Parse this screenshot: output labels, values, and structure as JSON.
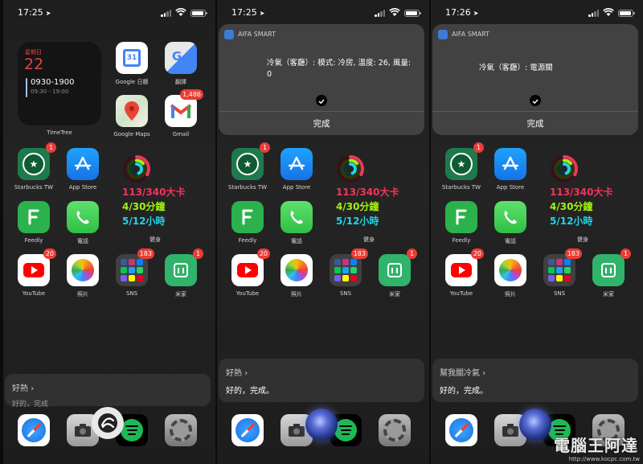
{
  "status": {
    "panel0_time": "17:25",
    "panel1_time": "17:25",
    "panel2_time": "17:26"
  },
  "calendar_widget": {
    "weekday": "星期日",
    "day": "22",
    "event_title": "0930-1900",
    "event_time": "09:30 - 19:00",
    "label": "TimeTree"
  },
  "apps": {
    "google_calendar": "Google 日曆",
    "translate": "翻譯",
    "google_maps": "Google Maps",
    "gmail": "Gmail",
    "gmail_badge": "1,486",
    "starbucks": "Starbucks TW",
    "starbucks_badge": "1",
    "app_store": "App Store",
    "feedly": "Feedly",
    "phone": "電話",
    "youtube": "YouTube",
    "youtube_badge": "20",
    "photos": "照片",
    "sns": "SNS",
    "sns_badge": "183",
    "mijia": "米家",
    "mijia_badge": "1",
    "gcal_day": "31"
  },
  "fitness": {
    "calories": "113/340大卡",
    "minutes": "4/30分鐘",
    "hours": "5/12小時",
    "label": "健身"
  },
  "notifications": {
    "app_name": "AIFA SMART",
    "panel1_message": "冷氣（客廳）: 模式: 冷房, 溫度: 26, 風量: 0",
    "panel2_message": "冷氣（客廳）: 電源關",
    "done_label": "完成"
  },
  "siri": {
    "panel0_query": "好熱",
    "panel0_partial": "好的，完成",
    "panel1_query": "好熱",
    "panel1_response": "好的，完成。",
    "panel2_query": "幫我關冷氣",
    "panel2_response": "好的，完成。"
  },
  "watermark": {
    "logo": "電腦王阿達",
    "url": "http://www.kocpc.com.tw"
  },
  "colors": {
    "move_ring": "#f2345c",
    "exercise_ring": "#a4f20f",
    "stand_ring": "#22d3e6",
    "badge": "#ea3d36"
  }
}
